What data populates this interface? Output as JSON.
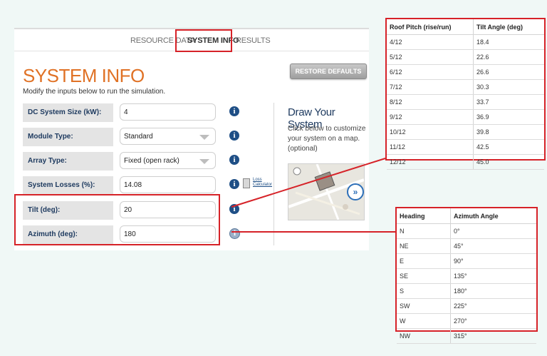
{
  "tabs": [
    {
      "label": "RESOURCE DATA"
    },
    {
      "label": "SYSTEM INFO"
    },
    {
      "label": "RESULTS"
    }
  ],
  "page": {
    "title": "SYSTEM INFO",
    "subtitle": "Modify the inputs below to run the simulation.",
    "restore_button": "RESTORE DEFAULTS"
  },
  "form": {
    "dc_size": {
      "label": "DC System Size (kW):",
      "value": "4"
    },
    "module_type": {
      "label": "Module Type:",
      "value": "Standard"
    },
    "array_type": {
      "label": "Array Type:",
      "value": "Fixed (open rack)"
    },
    "losses": {
      "label": "System Losses (%):",
      "value": "14.08",
      "calc_link_1": "Loss",
      "calc_link_2": "Calculator"
    },
    "tilt": {
      "label": "Tilt (deg):",
      "value": "20"
    },
    "azimuth": {
      "label": "Azimuth (deg):",
      "value": "180"
    }
  },
  "draw": {
    "title": "Draw Your System",
    "text": "Click below to customize your system on a map. (optional)"
  },
  "pitch_table": {
    "headers": [
      "Roof Pitch (rise/run)",
      "Tilt Angle (deg)"
    ],
    "rows": [
      [
        "4/12",
        "18.4"
      ],
      [
        "5/12",
        "22.6"
      ],
      [
        "6/12",
        "26.6"
      ],
      [
        "7/12",
        "30.3"
      ],
      [
        "8/12",
        "33.7"
      ],
      [
        "9/12",
        "36.9"
      ],
      [
        "10/12",
        "39.8"
      ],
      [
        "11/12",
        "42.5"
      ],
      [
        "12/12",
        "45.0"
      ]
    ]
  },
  "azimuth_table": {
    "headers": [
      "Heading",
      "Azimuth Angle"
    ],
    "rows": [
      [
        "N",
        "0°"
      ],
      [
        "NE",
        "45°"
      ],
      [
        "E",
        "90°"
      ],
      [
        "SE",
        "135°"
      ],
      [
        "S",
        "180°"
      ],
      [
        "SW",
        "225°"
      ],
      [
        "W",
        "270°"
      ],
      [
        "NW",
        "315°"
      ]
    ]
  },
  "colors": {
    "highlight": "#d62228",
    "title": "#e07226",
    "label_text": "#1f3b60",
    "info": "#1f4f86"
  }
}
